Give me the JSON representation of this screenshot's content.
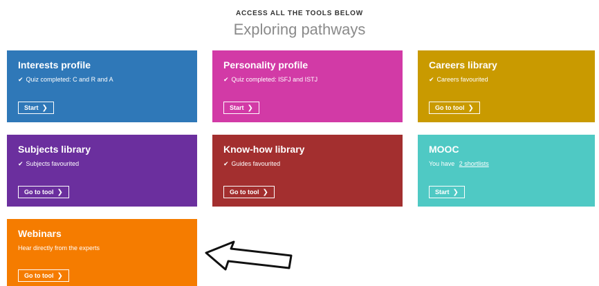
{
  "header": {
    "eyebrow": "ACCESS ALL THE TOOLS BELOW",
    "title": "Exploring pathways"
  },
  "cards": [
    {
      "title": "Interests profile",
      "status": "Quiz completed: C and R and A",
      "has_check": true,
      "button": "Start",
      "color": "#2f78b8"
    },
    {
      "title": "Personality profile",
      "status": "Quiz completed: ISFJ and ISTJ",
      "has_check": true,
      "button": "Start",
      "color": "#d23aa6"
    },
    {
      "title": "Careers library",
      "status": "Careers favourited",
      "has_check": true,
      "button": "Go to tool",
      "color": "#c99a00"
    },
    {
      "title": "Subjects library",
      "status": "Subjects favourited",
      "has_check": true,
      "button": "Go to tool",
      "color": "#6b2f9e"
    },
    {
      "title": "Know-how library",
      "status": "Guides favourited",
      "has_check": true,
      "button": "Go to tool",
      "color": "#a32f2f"
    },
    {
      "title": "MOOC",
      "status_prefix": "You have ",
      "status_link": "2 shortlists",
      "has_check": false,
      "button": "Start",
      "color": "#4fc9c4"
    },
    {
      "title": "Webinars",
      "status": "Hear directly from the experts",
      "has_check": false,
      "button": "Go to tool",
      "color": "#f57c00"
    }
  ],
  "icons": {
    "check": "checkmark-icon",
    "chevron": "chevron-right-icon",
    "pointer": "arrow-outline-icon"
  }
}
